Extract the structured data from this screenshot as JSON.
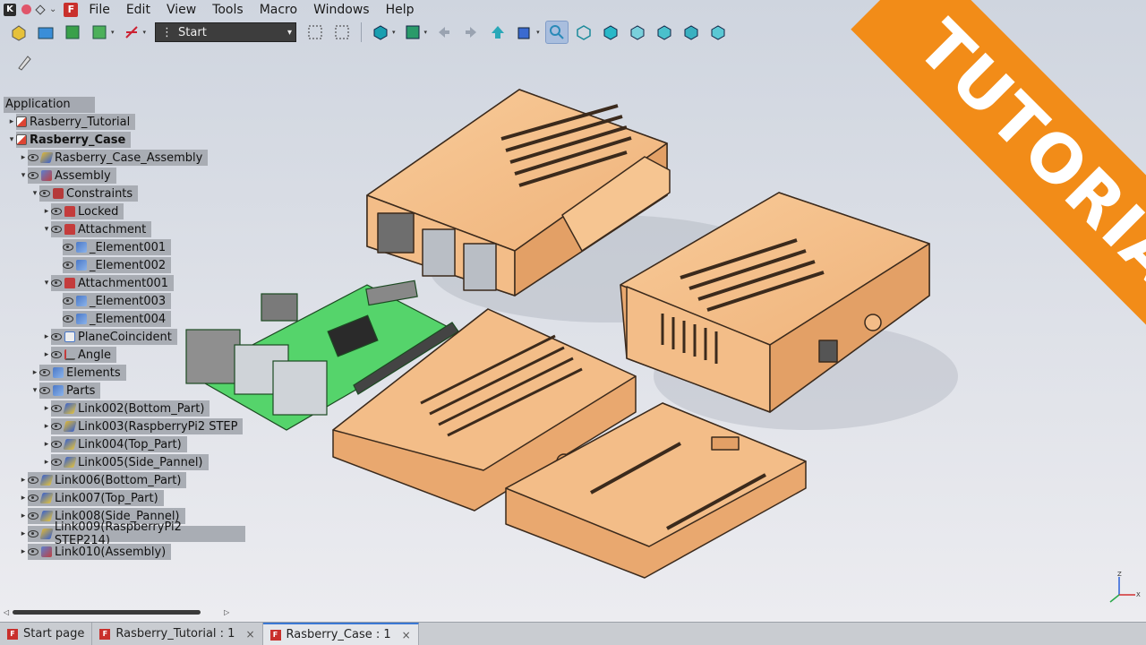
{
  "menu": {
    "items": [
      "File",
      "Edit",
      "View",
      "Tools",
      "Macro",
      "Windows",
      "Help"
    ]
  },
  "toolbar": {
    "workbench_value": "Start"
  },
  "tree": {
    "header": "Application",
    "rows": [
      {
        "label": "Rasberry_Tutorial",
        "indent": 0,
        "twist": "▸",
        "eye": false,
        "icon": "doc",
        "bold": false
      },
      {
        "label": "Rasberry_Case",
        "indent": 0,
        "twist": "▾",
        "eye": false,
        "icon": "doc",
        "bold": true
      },
      {
        "label": "Rasberry_Case_Assembly",
        "indent": 1,
        "twist": "▸",
        "eye": true,
        "icon": "ylink",
        "bold": false
      },
      {
        "label": "Assembly",
        "indent": 1,
        "twist": "▾",
        "eye": true,
        "icon": "asm",
        "bold": false
      },
      {
        "label": "Constraints",
        "indent": 2,
        "twist": "▾",
        "eye": true,
        "icon": "con",
        "bold": false
      },
      {
        "label": "Locked",
        "indent": 3,
        "twist": "▸",
        "eye": true,
        "icon": "lock",
        "bold": false
      },
      {
        "label": "Attachment",
        "indent": 3,
        "twist": "▾",
        "eye": true,
        "icon": "lock",
        "bold": false
      },
      {
        "label": "_Element001",
        "indent": 4,
        "twist": "",
        "eye": true,
        "icon": "elem",
        "bold": false
      },
      {
        "label": "_Element002",
        "indent": 4,
        "twist": "",
        "eye": true,
        "icon": "elem",
        "bold": false
      },
      {
        "label": "Attachment001",
        "indent": 3,
        "twist": "▾",
        "eye": true,
        "icon": "lock",
        "bold": false
      },
      {
        "label": "_Element003",
        "indent": 4,
        "twist": "",
        "eye": true,
        "icon": "elem",
        "bold": false
      },
      {
        "label": "_Element004",
        "indent": 4,
        "twist": "",
        "eye": true,
        "icon": "elem",
        "bold": false
      },
      {
        "label": "PlaneCoincident",
        "indent": 3,
        "twist": "▸",
        "eye": true,
        "icon": "plane",
        "bold": false
      },
      {
        "label": "Angle",
        "indent": 3,
        "twist": "▸",
        "eye": true,
        "icon": "angle",
        "bold": false
      },
      {
        "label": "Elements",
        "indent": 2,
        "twist": "▸",
        "eye": true,
        "icon": "elem",
        "bold": false
      },
      {
        "label": "Parts",
        "indent": 2,
        "twist": "▾",
        "eye": true,
        "icon": "elem",
        "bold": false
      },
      {
        "label": "Link002(Bottom_Part)",
        "indent": 3,
        "twist": "▸",
        "eye": true,
        "icon": "link",
        "bold": false
      },
      {
        "label": "Link003(RaspberryPi2 STEP",
        "indent": 3,
        "twist": "▸",
        "eye": true,
        "icon": "ylink",
        "bold": false
      },
      {
        "label": "Link004(Top_Part)",
        "indent": 3,
        "twist": "▸",
        "eye": true,
        "icon": "link",
        "bold": false
      },
      {
        "label": "Link005(Side_Pannel)",
        "indent": 3,
        "twist": "▸",
        "eye": true,
        "icon": "link",
        "bold": false
      },
      {
        "label": "Link006(Bottom_Part)",
        "indent": 1,
        "twist": "▸",
        "eye": true,
        "icon": "link",
        "bold": false
      },
      {
        "label": "Link007(Top_Part)",
        "indent": 1,
        "twist": "▸",
        "eye": true,
        "icon": "link",
        "bold": false
      },
      {
        "label": "Link008(Side_Pannel)",
        "indent": 1,
        "twist": "▸",
        "eye": true,
        "icon": "link",
        "bold": false
      },
      {
        "label": "Link009(RaspberryPi2 STEP214)",
        "indent": 1,
        "twist": "▸",
        "eye": true,
        "icon": "ylink",
        "bold": false
      },
      {
        "label": "Link010(Assembly)",
        "indent": 1,
        "twist": "▸",
        "eye": true,
        "icon": "asm",
        "bold": false
      }
    ]
  },
  "tabs": [
    {
      "label": "Start page",
      "active": false,
      "closable": false
    },
    {
      "label": "Rasberry_Tutorial : 1",
      "active": false,
      "closable": true
    },
    {
      "label": "Rasberry_Case : 1",
      "active": true,
      "closable": true
    }
  ],
  "banner": {
    "text": "TUTORIAL",
    "color": "#f28c18"
  },
  "colors": {
    "case": "#f5c28f",
    "board": "#4fd56a",
    "highlight": "#a9adb4"
  }
}
